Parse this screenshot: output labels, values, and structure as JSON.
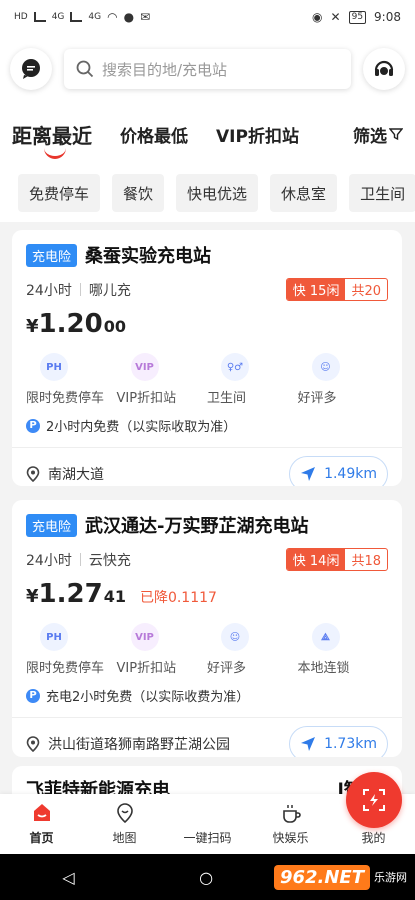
{
  "statusbar": {
    "time": "9:08",
    "battery": "95",
    "signal_labels": [
      "HD",
      "4G",
      "4G"
    ]
  },
  "header": {
    "search_placeholder": "搜索目的地/充电站"
  },
  "sort_tabs": [
    {
      "label": "距离最近",
      "active": true
    },
    {
      "label": "价格最低",
      "active": false
    },
    {
      "label": "VIP折扣站",
      "active": false
    }
  ],
  "filter_label": "筛选",
  "chips": [
    "免费停车",
    "餐饮",
    "快电优选",
    "休息室",
    "卫生间"
  ],
  "stations": [
    {
      "tag": "充电险",
      "name": "桑蚕实验充电站",
      "hours": "24小时",
      "operator": "哪儿充",
      "fast_free": "快 15闲",
      "total": "共20",
      "price_yen": "¥",
      "price_main": "1.20",
      "price_frac": "00",
      "discount": "",
      "features": [
        {
          "icon": "parking-icon",
          "glyph": "PH",
          "label": "限时免费停车"
        },
        {
          "icon": "vip-icon",
          "glyph": "VIP",
          "label": "VIP折扣站"
        },
        {
          "icon": "toilet-icon",
          "glyph": "♀♂",
          "label": "卫生间"
        },
        {
          "icon": "smile-icon",
          "glyph": "☺",
          "label": "好评多"
        }
      ],
      "parking_note": "2小时内免费（以实际收取为准）",
      "address": "南湖大道",
      "distance": "1.49km"
    },
    {
      "tag": "充电险",
      "name": "武汉通达-万实野芷湖充电站",
      "hours": "24小时",
      "operator": "云快充",
      "fast_free": "快 14闲",
      "total": "共18",
      "price_yen": "¥",
      "price_main": "1.27",
      "price_frac": "41",
      "discount": "已降0.1117",
      "features": [
        {
          "icon": "parking-icon",
          "glyph": "PH",
          "label": "限时免费停车"
        },
        {
          "icon": "vip-icon",
          "glyph": "VIP",
          "label": "VIP折扣站"
        },
        {
          "icon": "smile-icon",
          "glyph": "☺",
          "label": "好评多"
        },
        {
          "icon": "chain-icon",
          "glyph": "⟁",
          "label": "本地连锁"
        }
      ],
      "parking_note": "充电2小时免费（以实际收费为准）",
      "address": "洪山街道珞狮南路野芷湖公园",
      "distance": "1.73km"
    }
  ],
  "partial_station_name": "飞菲特新能源充电",
  "partial_station_suffix": "l智谷)",
  "nav": [
    {
      "label": "首页",
      "active": true
    },
    {
      "label": "地图",
      "active": false
    },
    {
      "label": "一键扫码",
      "active": false
    },
    {
      "label": "快娱乐",
      "active": false
    },
    {
      "label": "我的",
      "active": false
    }
  ],
  "watermark": {
    "logo": "962.NET",
    "sub": "乐游网"
  },
  "colors": {
    "accent": "#ef3a2f",
    "blue": "#2f8cf5",
    "orange": "#f0593a"
  }
}
